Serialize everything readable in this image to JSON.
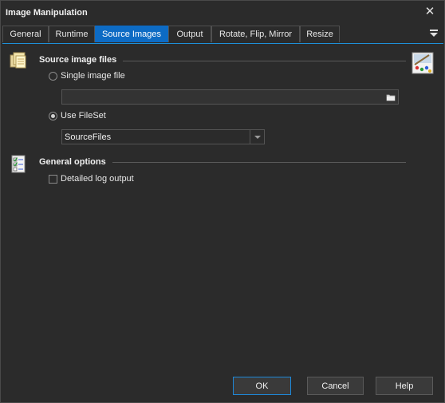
{
  "window": {
    "title": "Image Manipulation"
  },
  "tabs": [
    {
      "label": "General"
    },
    {
      "label": "Runtime"
    },
    {
      "label": "Source Images"
    },
    {
      "label": "Output"
    },
    {
      "label": "Rotate, Flip, Mirror"
    },
    {
      "label": "Resize"
    }
  ],
  "active_tab": "Source Images",
  "source_section": {
    "title": "Source image files",
    "single_label": "Single image file",
    "single_value": "",
    "fileset_label": "Use FileSet",
    "fileset_value": "SourceFiles",
    "selected": "Use FileSet"
  },
  "general_section": {
    "title": "General options",
    "detailed_log_label": "Detailed log output",
    "detailed_log_checked": false
  },
  "buttons": {
    "ok": "OK",
    "cancel": "Cancel",
    "help": "Help"
  },
  "colors": {
    "accent": "#0d6bc4",
    "background": "#2b2b2b"
  }
}
